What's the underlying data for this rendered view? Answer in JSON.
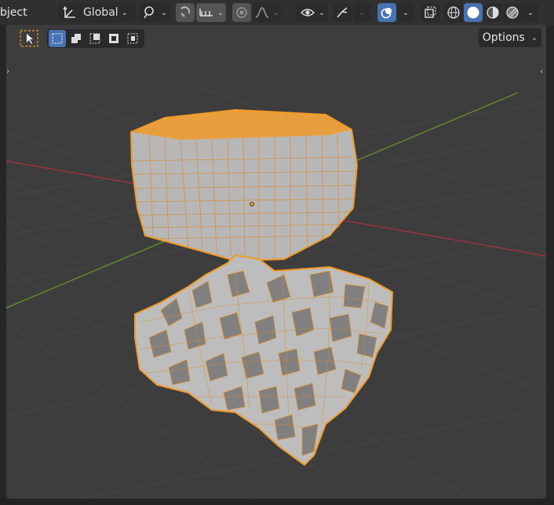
{
  "header": {
    "mode_label": "bject",
    "transform_orientation": "Global",
    "options_label": "Options"
  },
  "icons": {
    "transform_orientation": "orientation-axes-icon",
    "pivot": "link-pivot-icon",
    "snap": "snap-magnet-icon",
    "snap_target": "snap-increment-icon",
    "proportional": "proportional-edit-icon",
    "falloff": "falloff-curve-icon",
    "visibility": "eye-icon",
    "gizmo": "gizmo-icon",
    "overlays": "overlays-icon",
    "xray": "xray-icon",
    "shading_wire": "wireframe-shading-icon",
    "shading_solid": "solid-shading-icon",
    "shading_material": "material-shading-icon",
    "shading_rendered": "rendered-shading-icon",
    "select_tool": "select-cursor-icon"
  },
  "colors": {
    "viewport_bg": "#3d3d3d",
    "header_bg": "#303030",
    "accent": "#4772b3",
    "selection_outline": "#f5931e",
    "x_axis": "#b33040",
    "y_axis": "#6c9b2a",
    "mesh": "#b9b9b9"
  }
}
